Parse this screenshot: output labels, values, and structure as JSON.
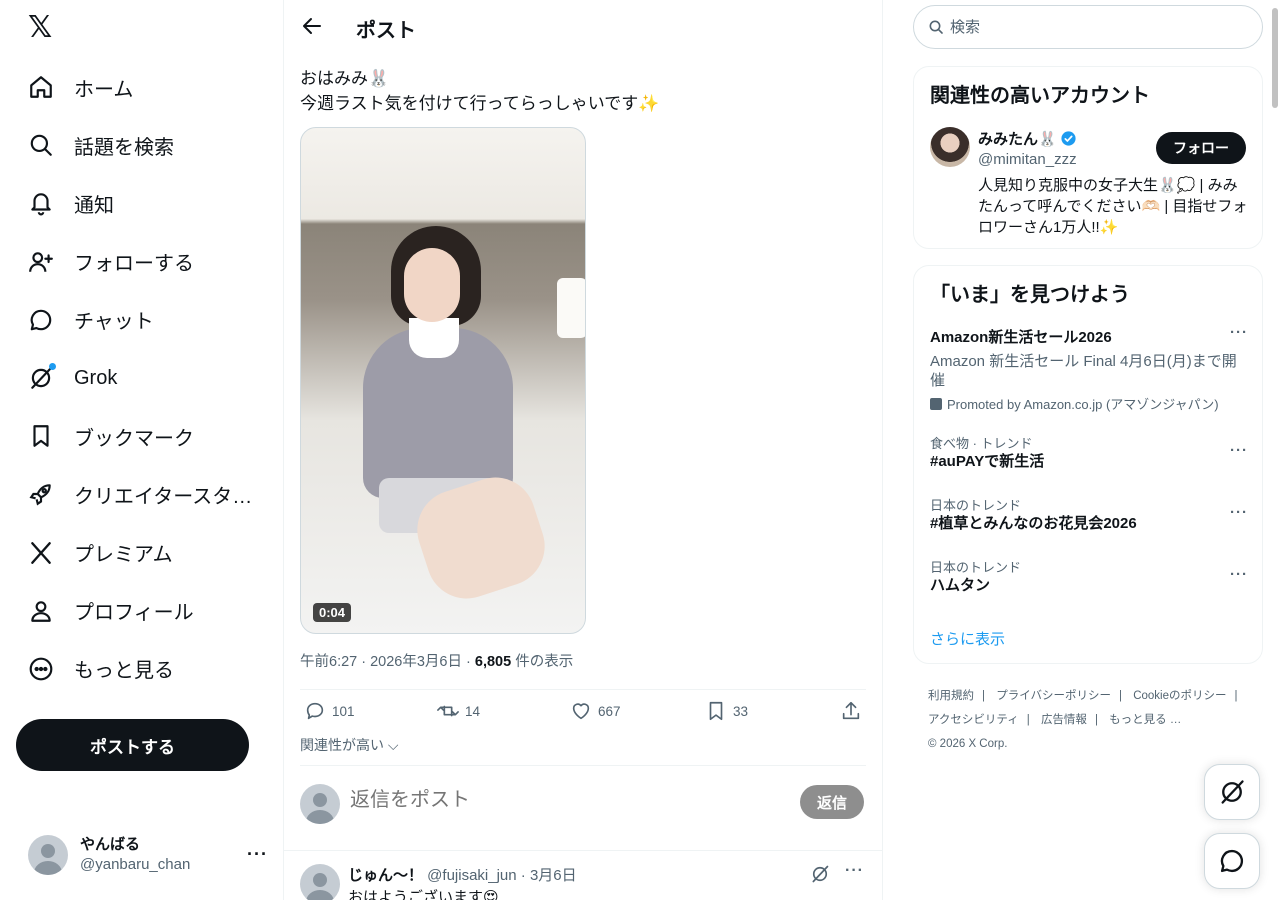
{
  "sidebar": {
    "logo": "𝕏",
    "items": [
      {
        "label": "ホーム",
        "icon": "home-icon"
      },
      {
        "label": "話題を検索",
        "icon": "search-icon"
      },
      {
        "label": "通知",
        "icon": "bell-icon"
      },
      {
        "label": "フォローする",
        "icon": "person-add-icon"
      },
      {
        "label": "チャット",
        "icon": "chat-icon"
      },
      {
        "label": "Grok",
        "icon": "grok-icon"
      },
      {
        "label": "ブックマーク",
        "icon": "bookmark-icon"
      },
      {
        "label": "クリエイタースタ…",
        "icon": "rocket-icon"
      },
      {
        "label": "プレミアム",
        "icon": "x-premium-icon"
      },
      {
        "label": "プロフィール",
        "icon": "profile-icon"
      },
      {
        "label": "もっと見る",
        "icon": "more-circle-icon"
      }
    ],
    "post_button": "ポストする",
    "account": {
      "name": "やんばる",
      "handle": "@yanbaru_chan",
      "more": "···"
    }
  },
  "main": {
    "header_title": "ポスト",
    "post": {
      "line1": "おはみみ🐰",
      "line2": "今週ラスト気を付けて行ってらっしゃいです✨",
      "video_duration": "0:04",
      "meta_time": "午前6:27 · 2026年3月6日 · ",
      "views_count": "6,805",
      "views_label": " 件の表示",
      "replies": "101",
      "reposts": "14",
      "likes": "667",
      "bookmarks": "33"
    },
    "relevance_label": "関連性が高い",
    "reply_placeholder": "返信をポスト",
    "reply_button": "返信",
    "first_reply": {
      "name": "じゅん〜！",
      "handle_date": " @fujisaki_jun · 3月6日",
      "text": "おはようございます😍",
      "more": "···"
    }
  },
  "right": {
    "search_placeholder": "検索",
    "related": {
      "title": "関連性の高いアカウント",
      "name": "みみたん🐰",
      "handle": "@mimitan_zzz",
      "follow": "フォロー",
      "bio": "人見知り克服中の女子大生🐰💭 | みみたんって呼んでください🫶🏻 | 目指せフォロワーさん1万人!!✨"
    },
    "explore": {
      "title": "「いま」を見つけよう",
      "trends": [
        {
          "category": "",
          "title": "Amazon新生活セール2026",
          "desc": "Amazon 新生活セール Final 4月6日(月)まで開催",
          "promo": "Promoted by Amazon.co.jp (アマゾンジャパン)"
        },
        {
          "category": "食べ物 · トレンド",
          "title": "#auPAYで新生活",
          "desc": "",
          "promo": ""
        },
        {
          "category": "日本のトレンド",
          "title": "#植草とみんなのお花見会2026",
          "desc": "",
          "promo": ""
        },
        {
          "category": "日本のトレンド",
          "title": "ハムタン",
          "desc": "",
          "promo": ""
        }
      ],
      "more_symbol": "···",
      "show_more": "さらに表示"
    },
    "footer": {
      "links": [
        "利用規約",
        "プライバシーポリシー",
        "Cookieのポリシー",
        "アクセシビリティ",
        "広告情報",
        "もっと見る …"
      ],
      "separator": "|",
      "copyright": "© 2026 X Corp."
    }
  },
  "colors": {
    "accent": "#1d9bf0",
    "text": "#0f1419",
    "muted": "#536471",
    "border": "#eff3f4"
  }
}
